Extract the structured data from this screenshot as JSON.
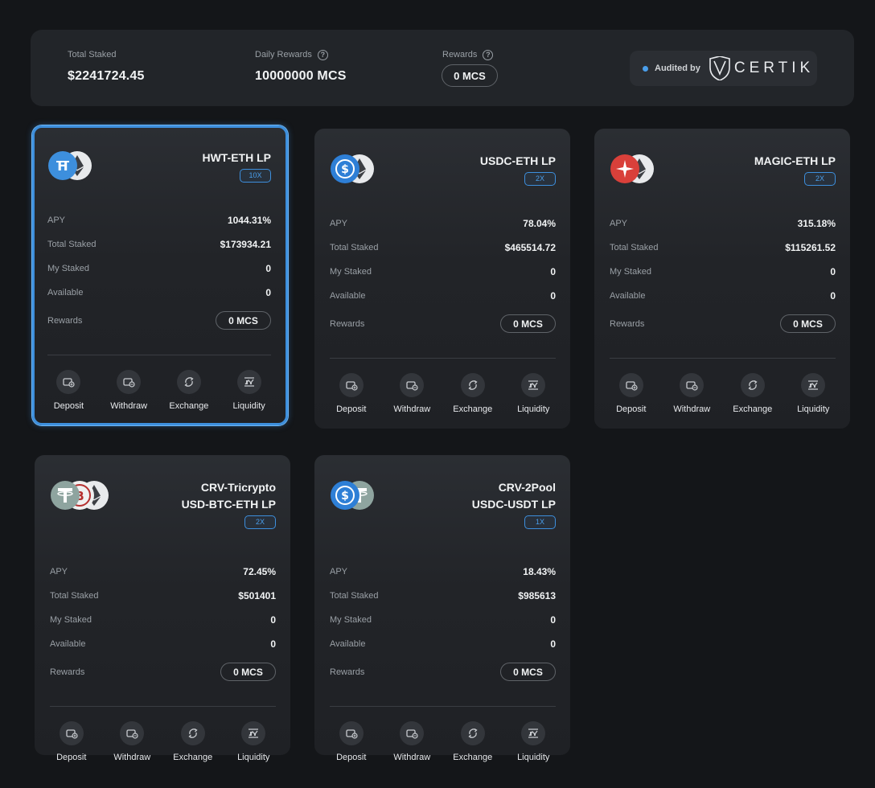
{
  "summary": {
    "total_staked_label": "Total Staked",
    "total_staked_value": "$2241724.45",
    "daily_rewards_label": "Daily Rewards",
    "daily_rewards_value": "10000000 MCS",
    "rewards_label": "Rewards",
    "rewards_value": "0 MCS",
    "audited_by": "Audited by",
    "auditor": "CERTIK"
  },
  "labels": {
    "apy": "APY",
    "total_staked": "Total Staked",
    "my_staked": "My Staked",
    "available": "Available",
    "rewards": "Rewards"
  },
  "actions": {
    "deposit": "Deposit",
    "withdraw": "Withdraw",
    "exchange": "Exchange",
    "liquidity": "Liquidity"
  },
  "pools": [
    {
      "name_line1": "HWT-ETH LP",
      "name_line2": "",
      "multiplier": "10X",
      "apy": "1044.31%",
      "total_staked": "$173934.21",
      "my_staked": "0",
      "available": "0",
      "rewards": "0 MCS",
      "tokens": [
        "hwt-icon",
        "eth-icon"
      ]
    },
    {
      "name_line1": "USDC-ETH LP",
      "name_line2": "",
      "multiplier": "2X",
      "apy": "78.04%",
      "total_staked": "$465514.72",
      "my_staked": "0",
      "available": "0",
      "rewards": "0 MCS",
      "tokens": [
        "usdc-icon",
        "eth-icon"
      ]
    },
    {
      "name_line1": "MAGIC-ETH LP",
      "name_line2": "",
      "multiplier": "2X",
      "apy": "315.18%",
      "total_staked": "$115261.52",
      "my_staked": "0",
      "available": "0",
      "rewards": "0 MCS",
      "tokens": [
        "magic-icon",
        "eth-icon"
      ]
    },
    {
      "name_line1": "CRV-Tricrypto",
      "name_line2": "USD-BTC-ETH LP",
      "multiplier": "2X",
      "apy": "72.45%",
      "total_staked": "$501401",
      "my_staked": "0",
      "available": "0",
      "rewards": "0 MCS",
      "tokens": [
        "usdt-icon",
        "btc-icon",
        "eth-icon"
      ]
    },
    {
      "name_line1": "CRV-2Pool",
      "name_line2": "USDC-USDT LP",
      "multiplier": "1X",
      "apy": "18.43%",
      "total_staked": "$985613",
      "my_staked": "0",
      "available": "0",
      "rewards": "0 MCS",
      "tokens": [
        "usdc-icon",
        "usdt-icon"
      ]
    }
  ],
  "colors": {
    "accent": "#3d8fdd",
    "background": "#141619",
    "card": "#25282c",
    "magic": "#d9403a",
    "usdc": "#2775ca",
    "usdt": "#7f9a95"
  }
}
